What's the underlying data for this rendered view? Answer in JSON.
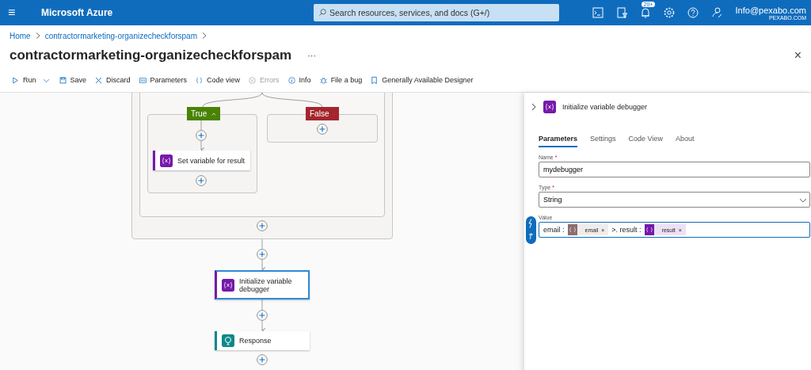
{
  "top_bar": {
    "menu": "≡",
    "brand": "Microsoft Azure",
    "search": {
      "placeholder": "Search resources, services, and docs (G+/)"
    },
    "notification_count": "20+",
    "account": {
      "email": "Info@pexabo.com",
      "tenant": "PEXABO.COM"
    }
  },
  "breadcrumb": [
    "Home",
    "contractormarketing-organizecheckforspam"
  ],
  "page_title": "contractormarketing-organizecheckforspam",
  "more": "···",
  "close": "×",
  "toolbar": [
    {
      "label": "Run",
      "kind": "run",
      "disabled": false
    },
    {
      "label": "Save",
      "kind": "save",
      "disabled": false
    },
    {
      "label": "Discard",
      "kind": "discard",
      "disabled": false
    },
    {
      "label": "Parameters",
      "kind": "parameters",
      "disabled": false
    },
    {
      "label": "Code view",
      "kind": "code",
      "disabled": false
    },
    {
      "label": "Errors",
      "kind": "errors",
      "disabled": true
    },
    {
      "label": "Info",
      "kind": "info",
      "disabled": false
    },
    {
      "label": "File a bug",
      "kind": "bug",
      "disabled": false
    },
    {
      "label": "Generally Available Designer",
      "kind": "bookmark",
      "disabled": false
    }
  ],
  "canvas": {
    "branches": [
      {
        "label": "True",
        "color": "#498205",
        "actions": [
          {
            "title": "Set variable for result",
            "kind": "variable",
            "selected": false
          }
        ]
      },
      {
        "label": "False",
        "color": "#a4262c"
      }
    ],
    "actions": [
      {
        "title": "Initialize variable debugger",
        "kind": "variable",
        "selected": true
      },
      {
        "title": "Response",
        "kind": "response",
        "selected": false
      }
    ]
  },
  "panel": {
    "title": "Initialize variable debugger",
    "kind": "variable",
    "tabs": [
      {
        "label": "Parameters",
        "selected": true
      },
      {
        "label": "Settings",
        "selected": false
      },
      {
        "label": "Code View",
        "selected": false
      },
      {
        "label": "About",
        "selected": false
      }
    ],
    "fields": [
      {
        "label": "Name",
        "required_mark": "*",
        "kind": "text",
        "value": "mydebugger"
      },
      {
        "label": "Type",
        "required_mark": "*",
        "kind": "select",
        "value": "String"
      },
      {
        "label": "Value",
        "kind": "tokens",
        "parts": [
          {
            "kind": "text",
            "text": "email :"
          },
          {
            "kind": "token",
            "text": "email",
            "remove": "×",
            "color": "#8c6e6e"
          },
          {
            "kind": "text",
            "text": ">. result :"
          },
          {
            "kind": "token",
            "text": "result",
            "remove": "×",
            "color": "#7719aa"
          }
        ]
      }
    ]
  }
}
